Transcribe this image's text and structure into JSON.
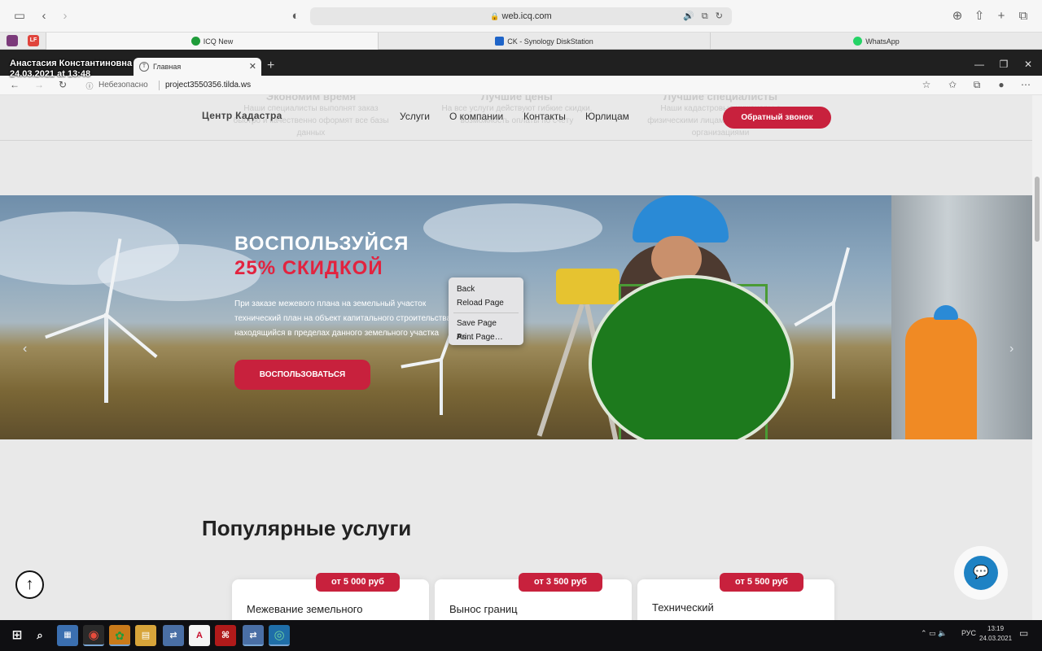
{
  "safari": {
    "address": "web.icq.com",
    "pinned_tabs": [
      {
        "label": "",
        "color": "#7b3a7a"
      },
      {
        "label": "LF",
        "color": "#e0443c"
      }
    ],
    "tabs": [
      {
        "label": "ICQ New",
        "icon": "icq-flower-icon",
        "color": "#1f9c3a",
        "active": true
      },
      {
        "label": "CK - Synology DiskStation",
        "icon": "synology-icon",
        "color": "#1e64c8",
        "active": false
      },
      {
        "label": "WhatsApp",
        "icon": "whatsapp-icon",
        "color": "#25d366",
        "active": false
      }
    ]
  },
  "overlay": {
    "name": "Анастасия Константиновна",
    "timestamp": "24.03.2021 at 13:48"
  },
  "edge": {
    "tab_label": "Главная",
    "security_label": "Небезопасно",
    "url": "project3550356.tilda.ws"
  },
  "site": {
    "logo": "Центр Кадастра",
    "nav": [
      "Услуги",
      "О компании",
      "Контакты",
      "Юрлицам"
    ],
    "callback": "Обратный звонок",
    "ghost_features": [
      {
        "title": "Экономим время",
        "text": "Наши специалисты выполнят заказ быстро и качественно оформят все базы данных"
      },
      {
        "title": "Лучшие цены",
        "text": "На все услуги действуют гибкие скидки, возможность оплаты по счёту"
      },
      {
        "title": "Лучшие специалисты",
        "text": "Наши кадастровые инженеры с физическими лицами и юридическими организациями"
      }
    ]
  },
  "hero": {
    "title_line1": "ВОСПОЛЬЗУЙСЯ",
    "title_line2": "25% СКИДКОЙ",
    "text_lines": [
      "При заказе межевого плана на земельный участок",
      "технический план на объект капитального строительства,",
      "находящийся в пределах данного земельного участка"
    ],
    "button": "ВОСПОЛЬЗОВАТЬСЯ"
  },
  "context_menu": {
    "items": [
      "Back",
      "Reload Page",
      "Save Page As…",
      "Print Page…"
    ]
  },
  "services": {
    "title": "Популярные услуги",
    "cards": [
      {
        "price": "от 5 000 руб",
        "title": "Межевание земельного"
      },
      {
        "price": "от 3 500 руб",
        "title": "Вынос границ"
      },
      {
        "price": "от 5 500 руб",
        "title": "Технический"
      }
    ]
  },
  "taskbar": {
    "language": "РУС",
    "time": "13:19",
    "date": "24.03.2021"
  },
  "colors": {
    "accent_red": "#c8213d",
    "hero_red_text": "#e2233f",
    "chat_blue": "#1e82c4"
  }
}
